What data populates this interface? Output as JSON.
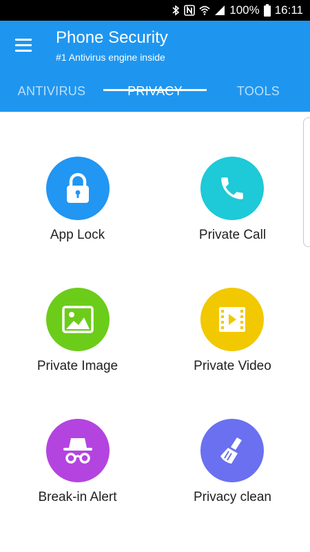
{
  "status_bar": {
    "battery": "100%",
    "time": "16:11",
    "icons": [
      "bluetooth-icon",
      "nfc-icon",
      "wifi-icon",
      "signal-icon",
      "battery-icon"
    ]
  },
  "app_bar": {
    "title": "Phone Security",
    "subtitle": "#1 Antivirus engine inside",
    "color": "#1e96f0"
  },
  "tabs": [
    {
      "label": "ANTIVIRUS",
      "active": false
    },
    {
      "label": "PRIVACY",
      "active": true
    },
    {
      "label": "TOOLS",
      "active": false
    }
  ],
  "features": [
    {
      "label": "App Lock",
      "icon": "lock-icon",
      "color": "#2196f3"
    },
    {
      "label": "Private Call",
      "icon": "phone-icon",
      "color": "#1ec9d8"
    },
    {
      "label": "Private Image",
      "icon": "image-icon",
      "color": "#6ccc1a"
    },
    {
      "label": "Private Video",
      "icon": "video-icon",
      "color": "#f2c800"
    },
    {
      "label": "Break-in Alert",
      "icon": "incognito-icon",
      "color": "#b444e0"
    },
    {
      "label": "Privacy clean",
      "icon": "broom-icon",
      "color": "#6a70f0"
    }
  ]
}
